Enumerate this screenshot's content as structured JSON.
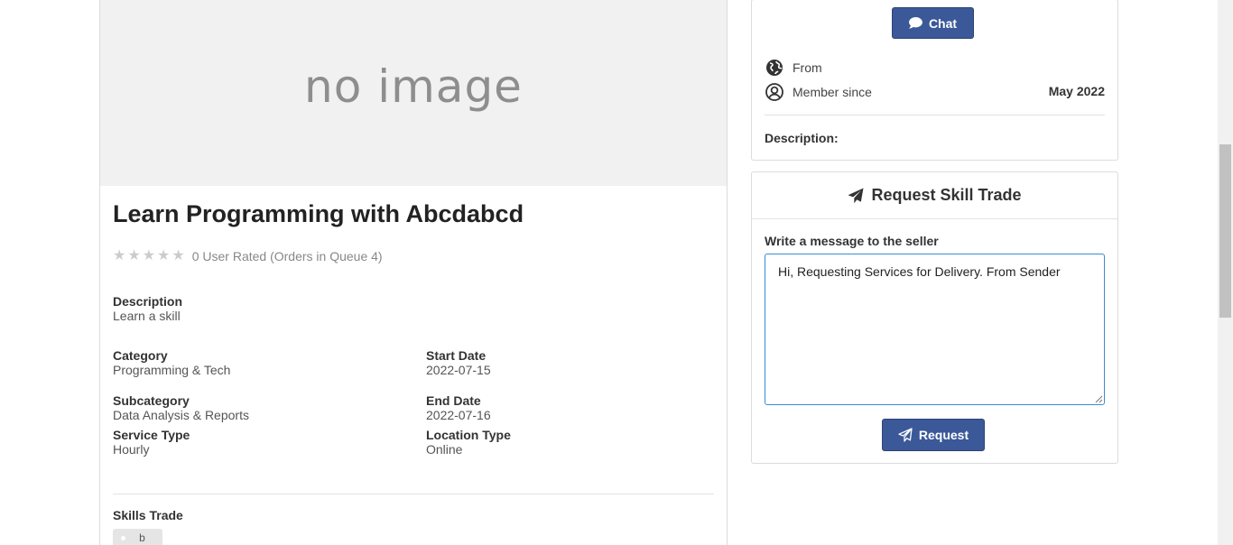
{
  "service": {
    "image_placeholder": "no image",
    "title": "Learn Programming with Abcdabcd",
    "rating_text": "0 User Rated (Orders in Queue 4)",
    "stars_filled": 0,
    "stars_total": 5,
    "description_label": "Description",
    "description_value": "Learn a skill",
    "category_label": "Category",
    "category_value": "Programming & Tech",
    "start_date_label": "Start Date",
    "start_date_value": "2022-07-15",
    "subcategory_label": "Subcategory",
    "subcategory_value": "Data Analysis & Reports",
    "end_date_label": "End Date",
    "end_date_value": "2022-07-16",
    "service_type_label": "Service Type",
    "service_type_value": "Hourly",
    "location_type_label": "Location Type",
    "location_type_value": "Online",
    "skills_label": "Skills Trade",
    "skills": [
      "b"
    ]
  },
  "seller": {
    "chat_label": "Chat",
    "from_label": "From",
    "member_since_label": "Member since",
    "member_since_value": "May 2022",
    "description_label": "Description:"
  },
  "request": {
    "title": "Request Skill Trade",
    "message_label": "Write a message to the seller",
    "message_value": "Hi, Requesting Services for Delivery. From Sender",
    "button_label": "Request"
  },
  "icons": {
    "chat": "chat-bubble-icon",
    "from": "globe-icon",
    "member": "user-circle-icon",
    "request_title": "paper-plane-icon",
    "request_button": "paper-plane-outline-icon"
  },
  "colors": {
    "primary": "#3b5998",
    "focus_border": "#3b8bd1",
    "star_empty": "#cccccc"
  }
}
